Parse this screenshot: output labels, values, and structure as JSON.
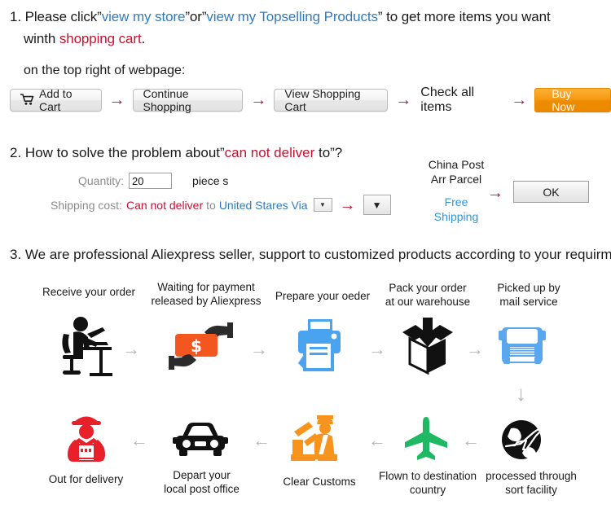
{
  "section1": {
    "number": "1.",
    "line1_a": "Please click”",
    "link_store": "view my store",
    "line1_b": "”or”",
    "link_topselling": "view my Topselling Products",
    "line1_c": "” to get more items you want",
    "line2_a": "winth ",
    "line2_highlight": "shopping cart",
    "line2_b": ".",
    "subtitle": "on the top right of webpage:",
    "buttons": {
      "add_to_cart": "Add to Cart",
      "cart_icon": "shopping-cart-icon",
      "continue_shopping": "Continue Shopping",
      "view_shopping_cart": "View Shopping Cart",
      "check_all_items": "Check all items",
      "buy_now": "Buy Now"
    },
    "arrow": "→"
  },
  "section2": {
    "number": "2.",
    "head_a": "How to solve the problem about”",
    "head_highlight": "can not deliver",
    "head_b": " to”?",
    "quantity_label": "Quantity:",
    "quantity_value": "20",
    "quantity_unit": "piece s",
    "shipping_label": "Shipping cost:",
    "shipping_cannot": "Can not deliver",
    "shipping_to": "to",
    "shipping_country": "United Stares Via",
    "select_caret": "▼",
    "arrow": "→",
    "carrier_line1": "China Post",
    "carrier_line2": "Arr Parcel",
    "carrier_free_line1": "Free",
    "carrier_free_line2": "Shipping",
    "ok_button": "OK"
  },
  "section3": {
    "number": "3.",
    "heading": "We are professional Aliexpress seller, support to customized products according to your requirment.",
    "arrow_right": "→",
    "arrow_left": "←",
    "arrow_down": "↓",
    "steps_top": [
      {
        "label_line1": "Receive your order",
        "label_line2": "",
        "icon": "person-at-desk-icon"
      },
      {
        "label_line1": "Waiting for payment",
        "label_line2": "released by Aliexpress",
        "icon": "money-in-hand-icon"
      },
      {
        "label_line1": "Prepare your oeder",
        "label_line2": "",
        "icon": "printer-icon"
      },
      {
        "label_line1": "Pack your order",
        "label_line2": "at our warehouse",
        "icon": "box-packing-icon"
      },
      {
        "label_line1": "Picked up by",
        "label_line2": "mail service",
        "icon": "truck-icon"
      }
    ],
    "steps_bottom": [
      {
        "label_line1": "Out for delivery",
        "label_line2": "",
        "icon": "delivery-person-icon"
      },
      {
        "label_line1": "Depart your",
        "label_line2": "local post office",
        "icon": "car-icon"
      },
      {
        "label_line1": "Clear Customs",
        "label_line2": "",
        "icon": "customs-officer-icon"
      },
      {
        "label_line1": "Flown to destination",
        "label_line2": "country",
        "icon": "airplane-icon"
      },
      {
        "label_line1": "processed through",
        "label_line2": "sort facility",
        "icon": "globe-plane-icon"
      }
    ]
  },
  "colors": {
    "link_blue": "#2f7bbf",
    "alert_red": "#c8102e",
    "buy_now_orange": "#ee8b00",
    "icon_blue": "#4aa3ef",
    "icon_orange": "#f26522",
    "icon_green": "#1fb963",
    "icon_red": "#e8202a",
    "arrow_grey": "#b5b5b5"
  }
}
